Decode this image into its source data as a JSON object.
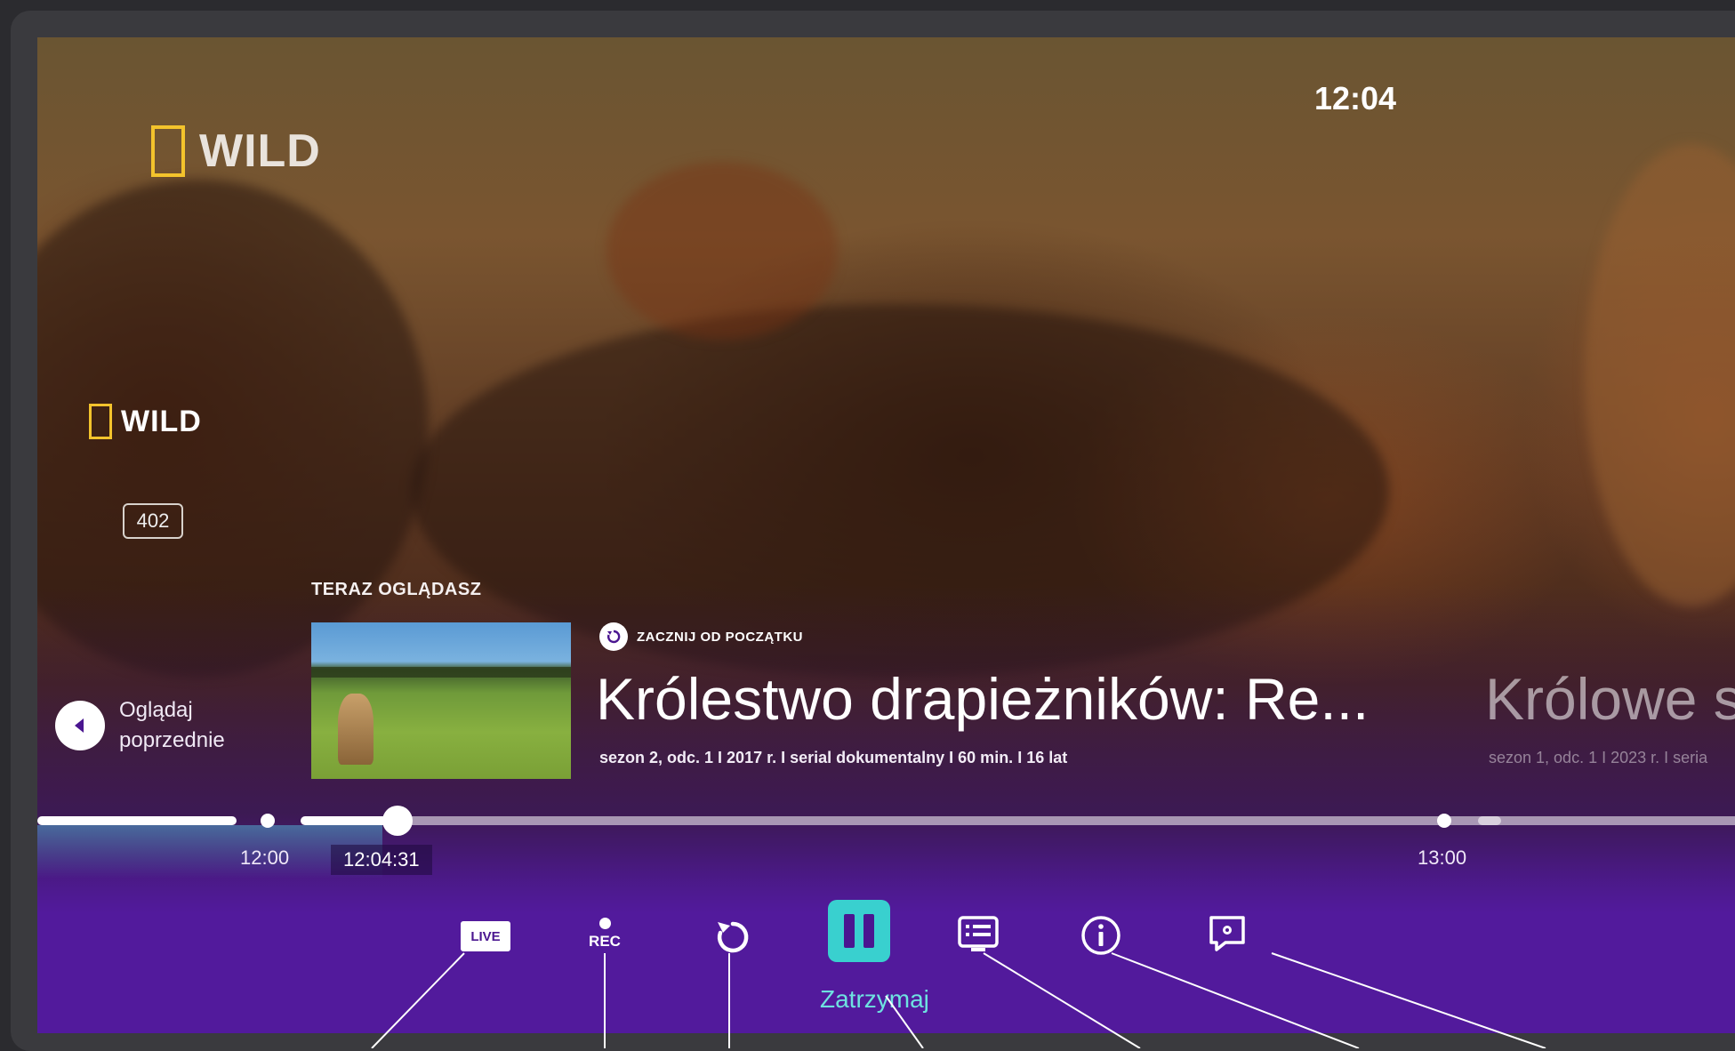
{
  "channel": {
    "brand_top": "WILD",
    "brand_small": "WILD",
    "number": "402"
  },
  "clock": "12:04",
  "previous": {
    "line1": "Oglądaj",
    "line2": "poprzednie"
  },
  "now_watching": {
    "label": "TERAZ OGLĄDASZ",
    "restart_label": "ZACZNIJ OD POCZĄTKU",
    "title": "Królestwo drapieżników: Re...",
    "meta": "sezon 2, odc. 1 I 2017 r. I serial dokumentalny I 60 min. I 16 lat"
  },
  "next_program": {
    "title": "Królowe s",
    "meta": "sezon 1, odc. 1 I 2023 r. I seria"
  },
  "timeline": {
    "start_label": "12:00",
    "current_label": "12:04:31",
    "end_label": "13:00",
    "progress": 0.07
  },
  "controls": {
    "live_label": "LIVE",
    "rec_label": "REC",
    "pause_label": "Zatrzymaj",
    "icons": [
      "live-icon",
      "record-icon",
      "replay-icon",
      "pause-icon",
      "epg-icon",
      "info-icon",
      "settings-icon"
    ]
  },
  "colors": {
    "accent": "#39d0cf",
    "panel": "#521a9c",
    "brand_box": "#f3c32c"
  }
}
